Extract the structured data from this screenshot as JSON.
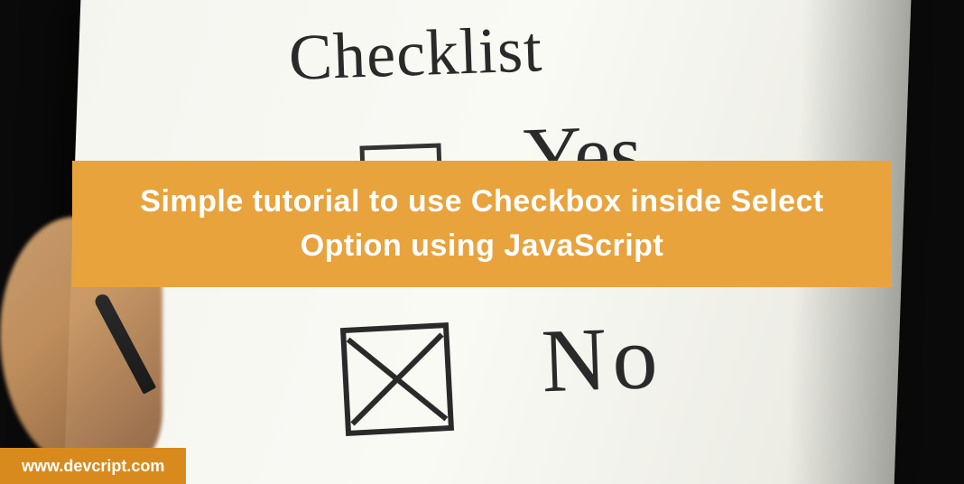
{
  "handwriting": {
    "title": "Checklist",
    "option_yes": "Yes",
    "option_no": "No"
  },
  "banner": {
    "title": "Simple tutorial to use Checkbox inside Select Option using JavaScript"
  },
  "footer": {
    "url": "www.devcript.com"
  },
  "colors": {
    "banner_bg": "#E8A33D",
    "footer_bg": "#D88B1C",
    "text_white": "#ffffff",
    "ink": "#2a2a2a"
  }
}
